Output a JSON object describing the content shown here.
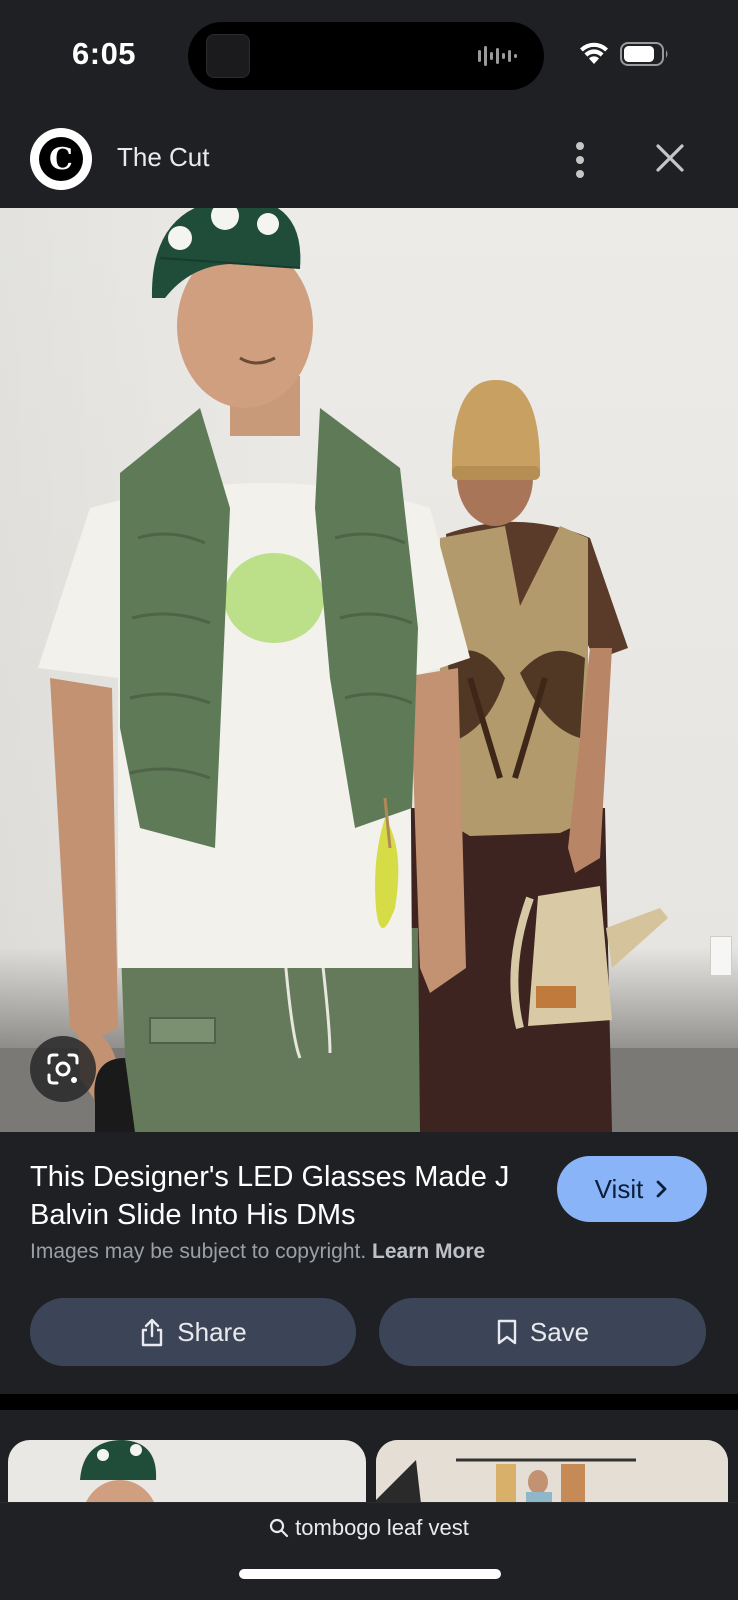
{
  "status_bar": {
    "time": "6:05"
  },
  "header": {
    "source_name": "The Cut",
    "logo_letter": "C"
  },
  "image": {
    "tag_text": "tombogo"
  },
  "caption": {
    "title": "This Designer's LED Glasses Made J Balvin Slide Into His DMs",
    "visit_label": "Visit",
    "copyright_text": "Images may be subject to copyright.",
    "learn_more_label": "Learn More"
  },
  "actions": {
    "share_label": "Share",
    "save_label": "Save"
  },
  "search": {
    "query": "tombogo leaf vest"
  },
  "colors": {
    "background": "#1f2023",
    "visit_button": "#8ab4f8",
    "action_button": "#3c4557"
  },
  "icons": [
    "the-cut-logo",
    "more-vert-icon",
    "close-icon",
    "google-lens-icon",
    "chevron-right-icon",
    "share-icon",
    "bookmark-icon",
    "search-icon",
    "wifi-icon",
    "battery-icon"
  ]
}
